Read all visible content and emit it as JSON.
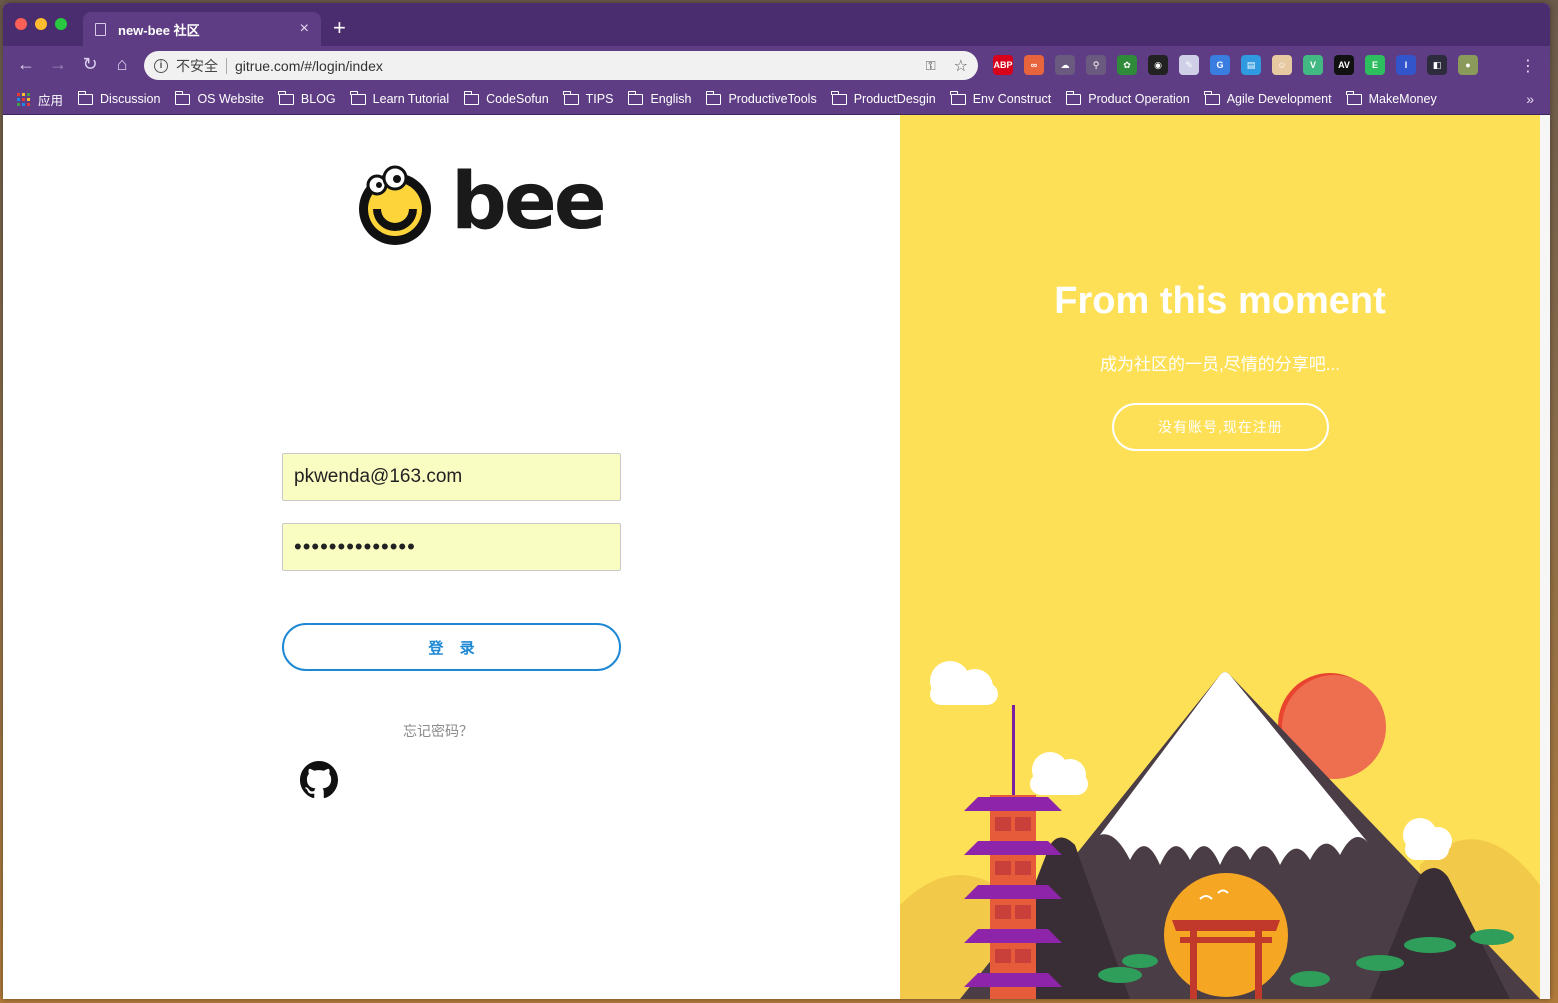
{
  "browser": {
    "tab_title": "new-bee 社区",
    "tab_close": "×",
    "new_tab": "+",
    "security_label": "不安全",
    "url": "gitrue.com/#/login/index",
    "back": "←",
    "forward": "→",
    "reload": "↻",
    "home": "⌂",
    "key_icon": "⚿",
    "star_icon": "☆",
    "menu": "⋮",
    "extensions": [
      {
        "name": "abp-icon",
        "text": "ABP",
        "color": "#d9001b"
      },
      {
        "name": "infinity-icon",
        "text": "∞",
        "color": "#e8643c"
      },
      {
        "name": "cloud-ext-icon",
        "text": "☁",
        "color": "#6a5a80"
      },
      {
        "name": "pin-ext-icon",
        "text": "⚲",
        "color": "#6a5a80"
      },
      {
        "name": "frog-ext-icon",
        "text": "✿",
        "color": "#2f8a3a"
      },
      {
        "name": "eye-ext-icon",
        "text": "◉",
        "color": "#222222"
      },
      {
        "name": "note-ext-icon",
        "text": "✎",
        "color": "#cfcfe8"
      },
      {
        "name": "translate-ext-icon",
        "text": "G",
        "color": "#3a7de0"
      },
      {
        "name": "doc-ext-icon",
        "text": "▤",
        "color": "#2f9ae0"
      },
      {
        "name": "face-ext-icon",
        "text": "☺",
        "color": "#e6c9a0"
      },
      {
        "name": "vue-ext-icon",
        "text": "V",
        "color": "#42b883"
      },
      {
        "name": "av-ext-icon",
        "text": "AV",
        "color": "#111111"
      },
      {
        "name": "evernote-ext-icon",
        "text": "E",
        "color": "#2dbe60"
      },
      {
        "name": "bar-ext-icon",
        "text": "I",
        "color": "#3355cc"
      },
      {
        "name": "dark-ext-icon",
        "text": "◧",
        "color": "#2c2c3c"
      },
      {
        "name": "profile-avatar-icon",
        "text": "●",
        "color": "#8a9a5a"
      }
    ],
    "bookmarks": [
      {
        "label": "应用",
        "type": "apps"
      },
      {
        "label": "Discussion",
        "type": "folder"
      },
      {
        "label": "OS Website",
        "type": "folder"
      },
      {
        "label": "BLOG",
        "type": "folder"
      },
      {
        "label": "Learn Tutorial",
        "type": "folder"
      },
      {
        "label": "CodeSofun",
        "type": "folder"
      },
      {
        "label": "TIPS",
        "type": "folder"
      },
      {
        "label": "English",
        "type": "folder"
      },
      {
        "label": "ProductiveTools",
        "type": "folder"
      },
      {
        "label": "ProductDesgin",
        "type": "folder"
      },
      {
        "label": "Env Construct",
        "type": "folder"
      },
      {
        "label": "Product Operation",
        "type": "folder"
      },
      {
        "label": "Agile Development",
        "type": "folder"
      },
      {
        "label": "MakeMoney",
        "type": "folder"
      }
    ],
    "bookmarks_more": "»"
  },
  "login": {
    "logo_text": "bee",
    "email_value": "pkwenda@163.com",
    "password_value": "••••••••••••••",
    "login_button": "登 录",
    "forgot_link": "忘记密码？"
  },
  "promo": {
    "title": "From this moment",
    "subtitle": "成为社区的一员,尽情的分享吧...",
    "register_button": "没有账号,现在注册"
  },
  "colors": {
    "browser_frame": "#5e3d85",
    "promo_bg": "#fee057",
    "accent_blue": "#1e88d4",
    "autofill_bg": "#fafdc2"
  }
}
